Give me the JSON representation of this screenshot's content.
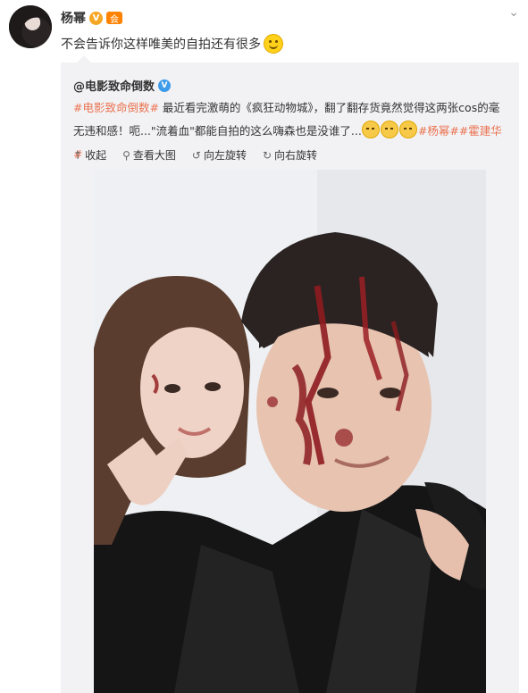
{
  "author": {
    "name": "杨幂",
    "verified_glyph": "V",
    "badge_glyph": "会"
  },
  "post": {
    "text": "不会告诉你这样唯美的自拍还有很多"
  },
  "repost": {
    "author": "@电影致命倒数",
    "verified_glyph": "V",
    "tag_open": "#电影致命倒数#",
    "text_part1": " 最近看完激萌的《疯狂动物城》，翻了翻存货竟然觉得这两张cos的毫无违和感！呃...\"流着血\"都能自拍的这么嗨森也是没谁了...",
    "tag_close": "#杨幂##霍建华#"
  },
  "actions": {
    "collapse": "收起",
    "view_large": "查看大图",
    "rotate_left": "向左旋转",
    "rotate_right": "向右旋转"
  },
  "icons": {
    "caret": "chevron-down-icon",
    "collapse": "arrow-up-icon",
    "view_large": "magnifier-icon",
    "rotate_left": "rotate-left-icon",
    "rotate_right": "rotate-right-icon"
  },
  "colors": {
    "tag": "#eb7350",
    "repost_bg": "#f2f2f5",
    "verified_gold": "#f5a623",
    "verified_blue": "#3e9be9"
  }
}
